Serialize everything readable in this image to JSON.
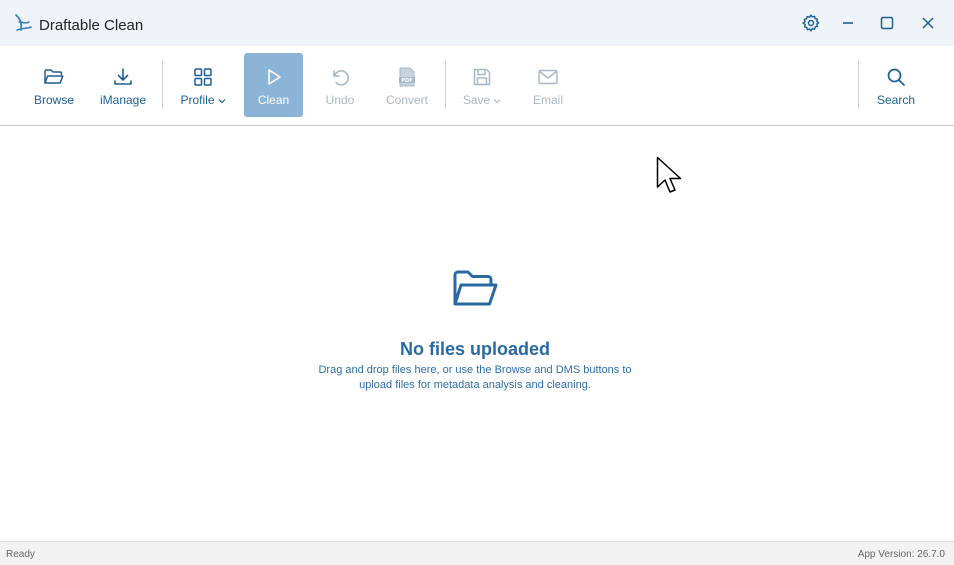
{
  "window": {
    "title": "Draftable Clean"
  },
  "toolbar": {
    "browse_label": "Browse",
    "imanage_label": "iManage",
    "profile_label": "Profile",
    "clean_label": "Clean",
    "undo_label": "Undo",
    "convert_label": "Convert",
    "save_label": "Save",
    "email_label": "Email",
    "search_label": "Search",
    "icons": {
      "browse": "folder-open-icon",
      "imanage": "download-icon",
      "profile": "grid-icon",
      "clean": "play-icon",
      "undo": "undo-icon",
      "convert": "pdf-icon",
      "save": "floppy-disk-icon",
      "email": "envelope-icon",
      "search": "search-icon"
    }
  },
  "empty_state": {
    "title": "No files uploaded",
    "description_line1": "Drag and drop files here, or use the Browse and DMS buttons to",
    "description_line2": "upload files for metadata analysis and cleaning."
  },
  "status": {
    "left": "Ready",
    "right": "App Version: 26.7.0"
  },
  "colors": {
    "accent": "#1d5f96",
    "active_button": "#8bb4d6",
    "titlebar_bg": "#eef4fa",
    "disabled_text": "#a9b8c6"
  }
}
